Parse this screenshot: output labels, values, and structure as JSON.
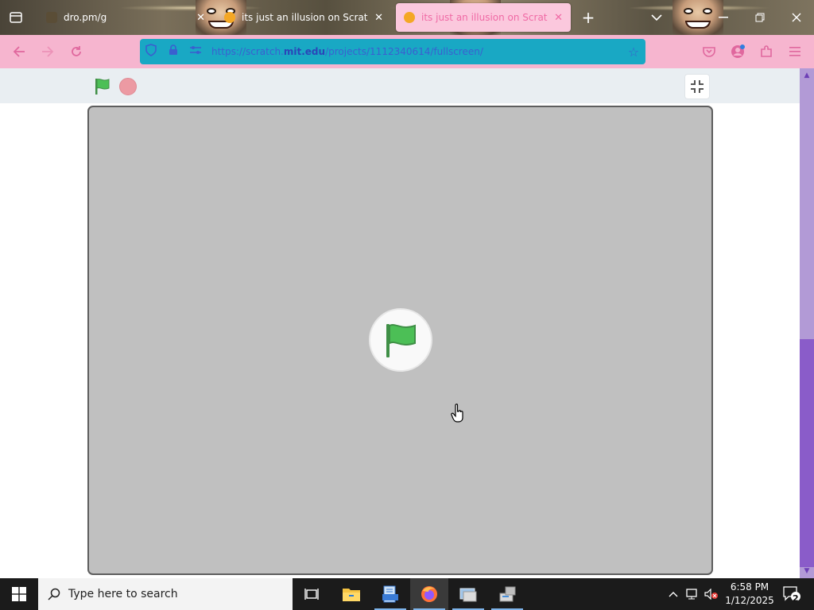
{
  "browser": {
    "tabs": [
      {
        "title": "dro.pm/g",
        "active": false
      },
      {
        "title": "its just an illusion on Scratch",
        "active": false
      },
      {
        "title": "its just an illusion on Scratch",
        "active": true
      }
    ],
    "new_tab_symbol": "+",
    "url": {
      "prefix": "https://scratch.",
      "domain": "mit.edu",
      "path": "/projects/1112340614/fullscreen/"
    }
  },
  "taskbar": {
    "search_placeholder": "Type here to search",
    "clock_time": "6:58 PM",
    "clock_date": "1/12/2025",
    "notification_count": "2"
  },
  "colors": {
    "tab_active_bg": "#fbc8dd",
    "toolbar_bg": "#f6b5cf",
    "urlbar_bg": "#19a8c4",
    "stage_bg": "#c0c0c0",
    "green_flag": "#4cbf56",
    "stop": "#ec9aa3"
  }
}
